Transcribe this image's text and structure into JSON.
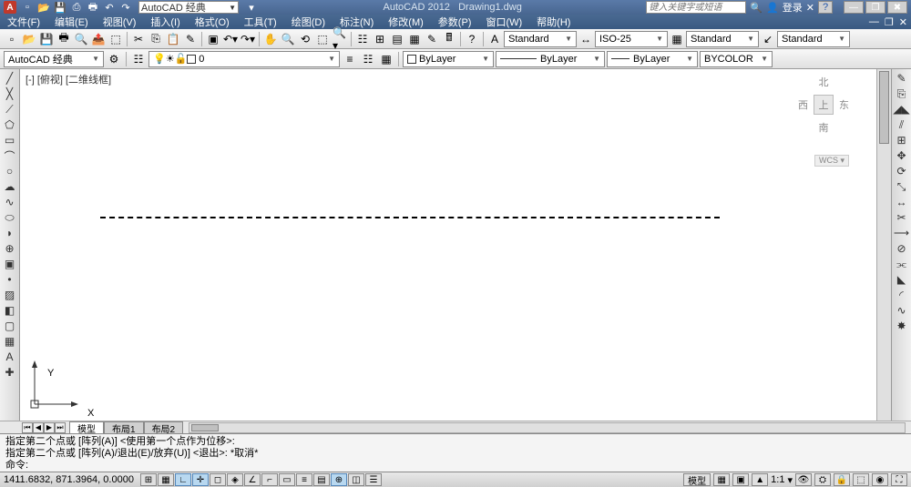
{
  "app": {
    "letter": "A"
  },
  "title": {
    "app": "AutoCAD 2012",
    "doc": "Drawing1.dwg"
  },
  "workspace_dd": "AutoCAD 经典",
  "search_placeholder": "键入关键字或短语",
  "login_label": "登录",
  "menus": [
    "文件(F)",
    "编辑(E)",
    "视图(V)",
    "插入(I)",
    "格式(O)",
    "工具(T)",
    "绘图(D)",
    "标注(N)",
    "修改(M)",
    "参数(P)",
    "窗口(W)",
    "帮助(H)"
  ],
  "style_dd1": "Standard",
  "dim_dd": "ISO-25",
  "style_dd2": "Standard",
  "style_dd3": "Standard",
  "workspace2": "AutoCAD 经典",
  "layer_name": "0",
  "bylayer1": "ByLayer",
  "bylayer2": "ByLayer",
  "bylayer3": "ByLayer",
  "bycolor": "BYCOLOR",
  "viewport_label": "[-] [俯视] [二维线框]",
  "nav": {
    "n": "北",
    "w": "西",
    "top": "上",
    "e": "东",
    "s": "南",
    "wcs": "WCS ▾"
  },
  "ucs": {
    "x": "X",
    "y": "Y"
  },
  "tabs": {
    "model": "模型",
    "layout1": "布局1",
    "layout2": "布局2"
  },
  "cmd": {
    "line1": "指定第二个点或 [阵列(A)] <使用第一个点作为位移>:",
    "line2": "指定第二个点或 [阵列(A)/退出(E)/放弃(U)] <退出>: *取消*",
    "prompt": "命令:"
  },
  "status": {
    "coords": "1411.6832, 871.3964, 0.0000",
    "space": "模型",
    "scale_icon": "▲",
    "scale": "1:1",
    "people": "⛭"
  }
}
